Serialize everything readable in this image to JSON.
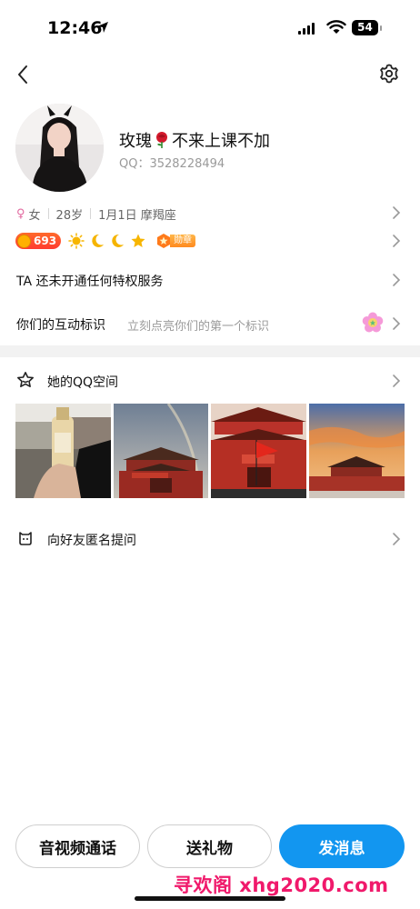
{
  "status_bar": {
    "time": "12:46",
    "battery": "54"
  },
  "profile": {
    "name_prefix": "玫瑰",
    "name_suffix": "不来上课不加",
    "qq_line": "QQ：3528228494",
    "gender": "女",
    "age": "28岁",
    "birthday_sign": "1月1日 摩羯座",
    "level": "693",
    "medal_label": "勋章"
  },
  "rows": {
    "privilege": "TA 还未开通任何特权服务",
    "interaction_title": "你们的互动标识",
    "interaction_hint": "立刻点亮你们的第一个标识"
  },
  "qzone": {
    "title": "她的QQ空间"
  },
  "anonymous": {
    "title": "向好友匿名提问"
  },
  "actions": {
    "call": "音视频通话",
    "gift": "送礼物",
    "message": "发消息"
  },
  "watermark": "寻欢阁 xhg2020.com",
  "colors": {
    "primary": "#1296f0",
    "level_badge": "#ff4a2d",
    "watermark": "#f0196b"
  }
}
